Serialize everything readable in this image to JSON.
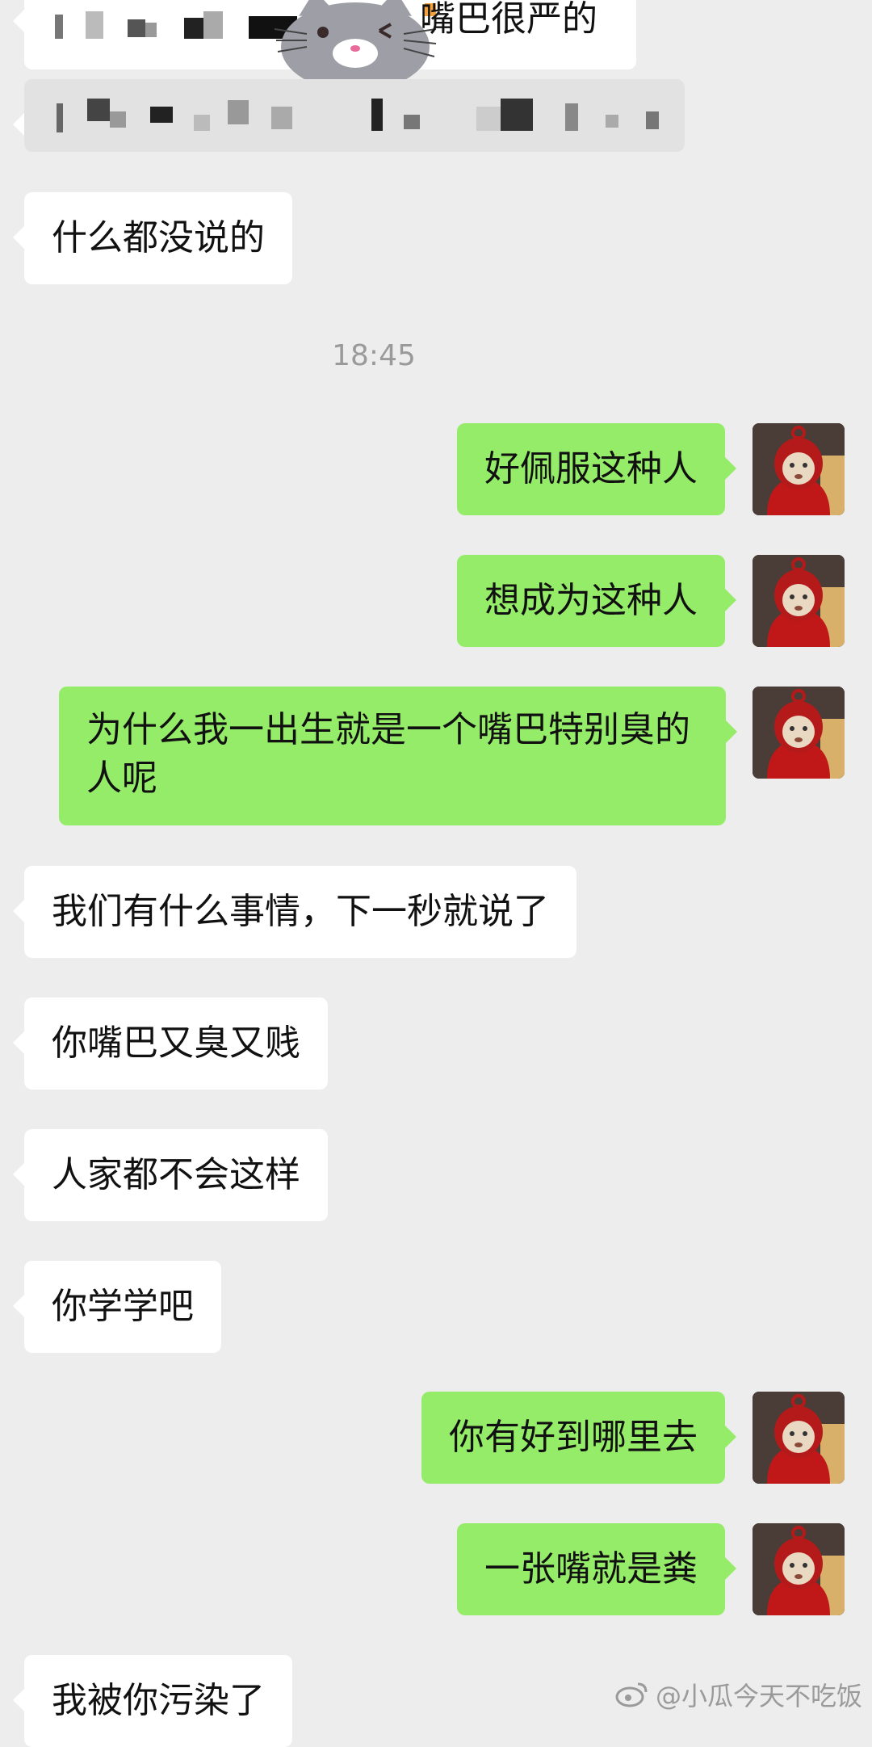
{
  "messages": {
    "m1": "嘴巴很严的",
    "m3": "什么都没说的",
    "m4": "好佩服这种人",
    "m5": "想成为这种人",
    "m6": "为什么我一出生就是一个嘴巴特别臭的人呢",
    "m7": "我们有什么事情，下一秒就说了",
    "m8": "你嘴巴又臭又贱",
    "m9": "人家都不会这样",
    "m10": "你学学吧",
    "m11": "你有好到哪里去",
    "m12": "一张嘴就是粪",
    "m13": "我被你污染了"
  },
  "time_label": "18:45",
  "watermark": "@小瓜今天不吃饭",
  "icons": {
    "cat_sticker": "gray-cat-sticker",
    "avatar": "red-teletubby-avatar",
    "weibo_logo": "weibo-logo-icon"
  },
  "colors": {
    "background": "#ededed",
    "incoming_bubble": "#ffffff",
    "outgoing_bubble": "#95ec69",
    "timestamp": "#9a9a9a"
  }
}
